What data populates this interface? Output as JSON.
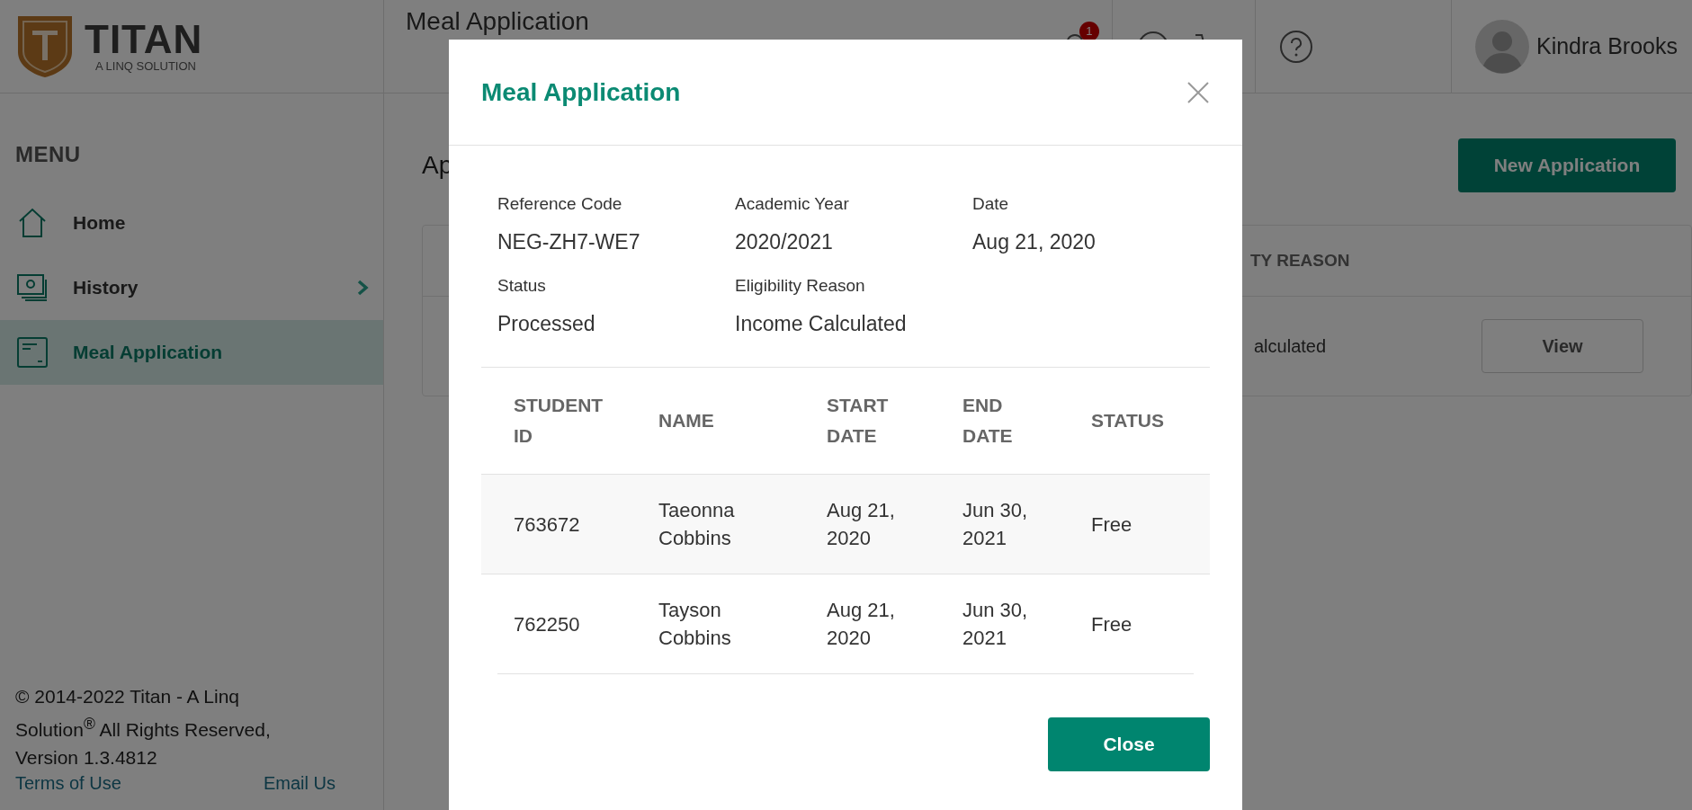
{
  "header": {
    "logo": {
      "name": "TITAN",
      "tagline": "A LINQ SOLUTION"
    },
    "page_title": "Meal Application",
    "notification_badge": "1",
    "user": {
      "name": "Kindra Brooks"
    }
  },
  "sidebar": {
    "heading": "MENU",
    "items": [
      {
        "label": "Home",
        "kind": "home",
        "selected": false,
        "has_submenu": false
      },
      {
        "label": "History",
        "kind": "history",
        "selected": false,
        "has_submenu": true
      },
      {
        "label": "Meal Application",
        "kind": "form",
        "selected": true,
        "has_submenu": false
      }
    ],
    "footer": {
      "copyright": "© 2014-2022 Titan - A Linq Solution$^{®}$ All Rights Reserved, Version 1.3.4812",
      "links": [
        "Terms of Use",
        "Email Us"
      ]
    }
  },
  "main": {
    "page_title": "Ap",
    "new_button": "New Application",
    "table": {
      "column": "TY REASON",
      "cell": "alculated",
      "action": "View"
    }
  },
  "modal": {
    "title": "Meal Application",
    "fields": [
      {
        "label": "Reference Code",
        "value": "NEG-ZH7-WE7"
      },
      {
        "label": "Academic Year",
        "value": "2020/2021"
      },
      {
        "label": "Date",
        "value": "Aug 21, 2020"
      },
      {
        "label": "Status",
        "value": "Processed"
      },
      {
        "label": "Eligibility Reason",
        "value": "Income Calculated"
      }
    ],
    "table": {
      "columns": [
        "STUDENT ID",
        "NAME",
        "START DATE",
        "END DATE",
        "STATUS"
      ],
      "rows": [
        {
          "highlighted": true,
          "cells": [
            "763672",
            "Taeonna Cobbins",
            "Aug 21, 2020",
            "Jun 30, 2021",
            "Free"
          ]
        },
        {
          "highlighted": false,
          "cells": [
            "762250",
            "Tayson Cobbins",
            "Aug 21, 2020",
            "Jun 30, 2021",
            "Free"
          ]
        }
      ]
    },
    "close_button": "Close"
  }
}
